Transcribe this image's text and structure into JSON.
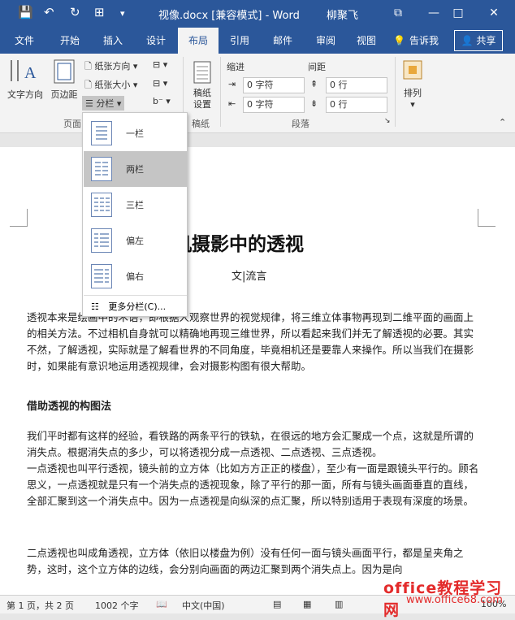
{
  "titlebar": {
    "title": "视像.docx [兼容模式] - Word",
    "user": "柳聚飞",
    "qat_save": "💾",
    "qat_undo": "↶",
    "qat_redo": "↻",
    "qat_layout": "⊞",
    "qat_more": "▾",
    "win_restore": "⧉",
    "win_min": "—",
    "win_max": "□",
    "win_close": "✕"
  },
  "tabs": [
    "文件",
    "开始",
    "插入",
    "设计",
    "布局",
    "引用",
    "邮件",
    "审阅",
    "视图",
    "告诉我",
    "共享"
  ],
  "ribbon": {
    "text_direction": "文字方向",
    "margins": "页边距",
    "orientation": "纸张方向",
    "size": "纸张大小",
    "columns": "分栏",
    "breaks": "",
    "page_group_partial": "页面",
    "manuscript": "稿纸\n设置",
    "manuscript_group": "稿纸",
    "indent_label": "缩进",
    "spacing_label": "间距",
    "indent_left": "0 字符",
    "indent_right": "0 字符",
    "space_before": "0 行",
    "space_after": "0 行",
    "paragraph_group": "段落",
    "arrange": "排列"
  },
  "columns_menu": {
    "items": [
      "一栏",
      "两栏",
      "三栏",
      "偏左",
      "偏右"
    ],
    "more": "更多分栏(C)..."
  },
  "document": {
    "title": "机摄影中的透视",
    "author": "文|流言",
    "para1": "透视本来是绘画中的术语，即根据人观察世界的视觉规律，将三维立体事物再现到二维平面的画面上的相关方法。不过相机自身就可以精确地再现三维世界，所以看起来我们并无了解透视的必要。其实不然，了解透视，实际就是了解看世界的不同角度，毕竟相机还是要靠人来操作。所以当我们在摄影时，如果能有意识地运用透视规律，会对摄影构图有很大帮助。",
    "heading": "借助透视的构图法",
    "para2": "我们平时都有这样的经验，看铁路的两条平行的铁轨，在很远的地方会汇聚成一个点，这就是所谓的消失点。根据消失点的多少，可以将透视分成一点透视、二点透视、三点透视。",
    "para3": "一点透视也叫平行透视，镜头前的立方体（比如方方正正的楼盘），至少有一面是跟镜头平行的。顾名思义，一点透视就是只有一个消失点的透视现象，除了平行的那一面，所有与镜头画面垂直的直线，全部汇聚到这一个消失点中。因为一点透视是向纵深的点汇聚，所以特别适用于表现有深度的场景。",
    "para4": "二点透视也叫成角透视，立方体（依旧以楼盘为例）没有任何一面与镜头画面平行，都是呈夹角之势，这时，这个立方体的边线，会分别向画面的两边汇聚到两个消失点上。因为是向"
  },
  "status": {
    "page": "第 1 页，共 2 页",
    "words": "1002 个字",
    "lang": "中文(中国)",
    "zoom": "100%"
  },
  "watermark": {
    "text": "office教程学习网",
    "url": "www.office68.com"
  }
}
